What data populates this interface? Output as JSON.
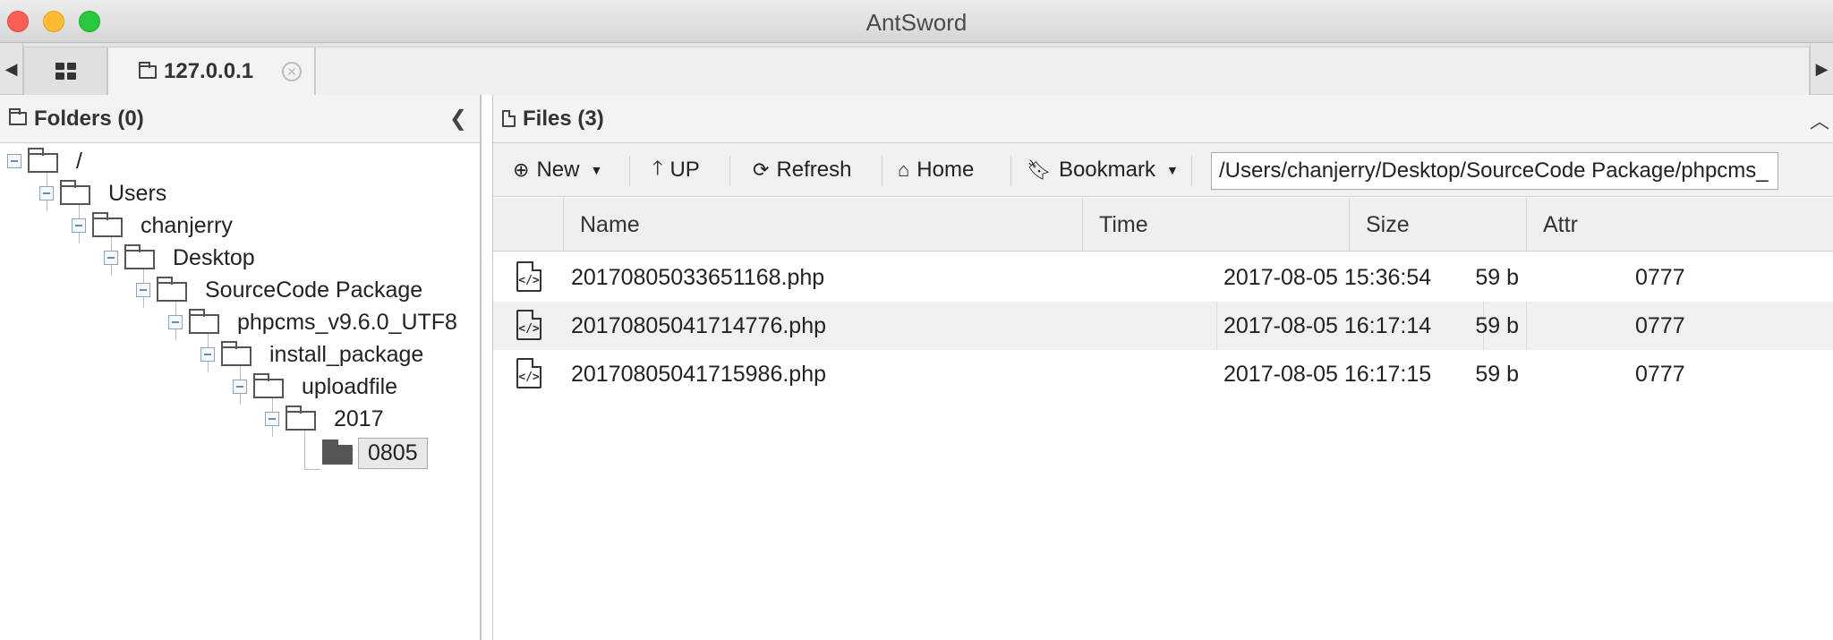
{
  "window": {
    "title": "AntSword"
  },
  "tabs": {
    "home_icon": "grid-icon",
    "host_tab_label": "127.0.0.1",
    "close_icon": "close-circle-icon"
  },
  "folders_panel": {
    "title": "Folders (0)",
    "tree": [
      {
        "label": "/",
        "level": 0
      },
      {
        "label": "Users",
        "level": 1
      },
      {
        "label": "chanjerry",
        "level": 2
      },
      {
        "label": "Desktop",
        "level": 3
      },
      {
        "label": "SourceCode Package",
        "level": 4
      },
      {
        "label": "phpcms_v9.6.0_UTF8",
        "level": 5
      },
      {
        "label": "install_package",
        "level": 6
      },
      {
        "label": "uploadfile",
        "level": 7
      },
      {
        "label": "2017",
        "level": 8
      },
      {
        "label": "0805",
        "level": 9,
        "selected": true
      }
    ]
  },
  "files_panel": {
    "title": "Files (3)",
    "toolbar": {
      "new_label": "New",
      "up_label": "UP",
      "refresh_label": "Refresh",
      "home_label": "Home",
      "bookmark_label": "Bookmark",
      "path_value": "/Users/chanjerry/Desktop/SourceCode Package/phpcms_"
    },
    "columns": {
      "name": "Name",
      "time": "Time",
      "size": "Size",
      "attr": "Attr"
    },
    "rows": [
      {
        "name": "20170805033651168.php",
        "time": "2017-08-05 15:36:54",
        "size": "59 b",
        "attr": "0777"
      },
      {
        "name": "20170805041714776.php",
        "time": "2017-08-05 16:17:14",
        "size": "59 b",
        "attr": "0777"
      },
      {
        "name": "20170805041715986.php",
        "time": "2017-08-05 16:17:15",
        "size": "59 b",
        "attr": "0777"
      }
    ]
  }
}
